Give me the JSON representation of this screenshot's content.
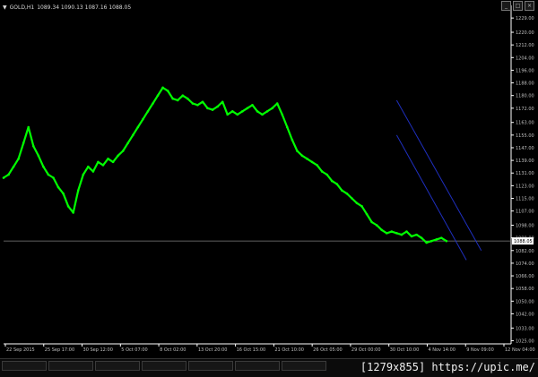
{
  "info": {
    "symbol_timeframe": "GOLD,H1",
    "ohlc": "1089.34 1090.13 1087.16 1088.05"
  },
  "colors": {
    "background": "#000000",
    "candles": "#00ff00",
    "axis": "#ffffff",
    "grid_label": "#bfbfbf",
    "trendline": "#1f2fbf",
    "price_line": "#808080"
  },
  "watermark": "[1279x855] https://upic.me/",
  "chart_data": {
    "type": "line",
    "title": "",
    "ylim": [
      1023,
      1237
    ],
    "y_ticks": [
      "1229.00",
      "1220.00",
      "1212.00",
      "1204.00",
      "1196.00",
      "1188.00",
      "1180.00",
      "1172.00",
      "1163.00",
      "1155.00",
      "1147.00",
      "1139.00",
      "1131.00",
      "1123.00",
      "1115.00",
      "1107.00",
      "1098.00",
      "1090.00",
      "1082.00",
      "1074.00",
      "1066.00",
      "1058.00",
      "1050.00",
      "1042.00",
      "1033.00",
      "1025.00"
    ],
    "x_ticks": [
      "22 Sep 2015",
      "25 Sep 17:00",
      "30 Sep 12:00",
      "5 Oct 07:00",
      "8 Oct 02:00",
      "13 Oct 20:00",
      "16 Oct 15:00",
      "21 Oct 10:00",
      "26 Oct 05:00",
      "29 Oct 00:00",
      "30 Oct 10:00",
      "4 Nov 14:00",
      "9 Nov 09:00",
      "12 Nov 04:00"
    ],
    "current_price": "1088.05",
    "series": [
      {
        "x": [
          0,
          1,
          2,
          3,
          4,
          5,
          6,
          7,
          8,
          9,
          10,
          11,
          12,
          13,
          14,
          15,
          16,
          17,
          18,
          19,
          20,
          21,
          22,
          23,
          24,
          25,
          26,
          27,
          28,
          29,
          30,
          31,
          32,
          33,
          34,
          35,
          36,
          37,
          38,
          39,
          40,
          41,
          42,
          43,
          44,
          45,
          46,
          47,
          48,
          49,
          50,
          51,
          52,
          53,
          54,
          55,
          56,
          57,
          58,
          59,
          60,
          61,
          62,
          63,
          64,
          65,
          66,
          67,
          68,
          69,
          70,
          71,
          72,
          73,
          74,
          75,
          76,
          77,
          78,
          79,
          80,
          81,
          82,
          83,
          84,
          85,
          86,
          87,
          88,
          89
        ],
        "y": [
          1128,
          1130,
          1135,
          1140,
          1150,
          1160,
          1148,
          1142,
          1135,
          1130,
          1128,
          1122,
          1118,
          1110,
          1106,
          1120,
          1130,
          1135,
          1132,
          1138,
          1136,
          1140,
          1138,
          1142,
          1145,
          1150,
          1155,
          1160,
          1165,
          1170,
          1175,
          1180,
          1185,
          1183,
          1178,
          1177,
          1180,
          1178,
          1175,
          1174,
          1176,
          1172,
          1171,
          1173,
          1176,
          1168,
          1170,
          1168,
          1170,
          1172,
          1174,
          1170,
          1168,
          1170,
          1172,
          1175,
          1168,
          1160,
          1152,
          1145,
          1142,
          1140,
          1138,
          1136,
          1132,
          1130,
          1126,
          1124,
          1120,
          1118,
          1115,
          1112,
          1110,
          1105,
          1100,
          1098,
          1095,
          1093,
          1094,
          1093,
          1092,
          1094,
          1091,
          1092,
          1090,
          1087,
          1088,
          1089,
          1090,
          1088
        ]
      }
    ],
    "trendlines": [
      {
        "x": [
          79,
          93
        ],
        "y": [
          1155,
          1076
        ]
      },
      {
        "x": [
          79,
          96
        ],
        "y": [
          1177,
          1082
        ]
      }
    ],
    "x_range": [
      0,
      102
    ]
  }
}
